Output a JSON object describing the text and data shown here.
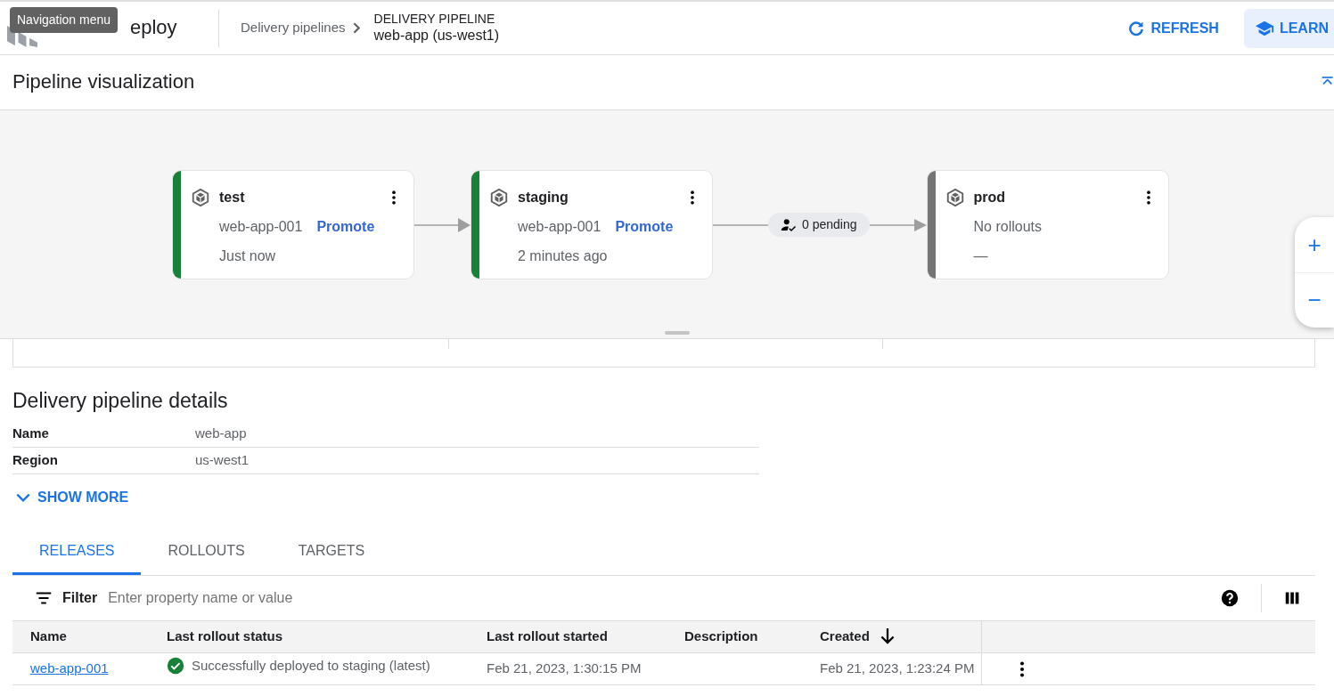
{
  "header": {
    "tooltip": "Navigation menu",
    "product": "eploy",
    "breadcrumb": [
      {
        "label": "Delivery pipelines"
      }
    ],
    "page_kind": "DELIVERY PIPELINE",
    "page_title": "web-app (us-west1)",
    "actions": [
      {
        "label": "REFRESH",
        "kind": "refresh"
      },
      {
        "label": "LEARN",
        "kind": "learn"
      }
    ]
  },
  "pipeline": {
    "title": "Pipeline visualization",
    "targets": [
      {
        "name": "test",
        "release": "web-app-001",
        "action": "Promote",
        "time": "Just now",
        "color": "#188038"
      },
      {
        "name": "staging",
        "release": "web-app-001",
        "action": "Promote",
        "time": "2 minutes ago",
        "color": "#188038"
      },
      {
        "name": "prod",
        "release": "No rollouts",
        "time": "—",
        "color": "#757575",
        "pending": "0 pending"
      }
    ],
    "zoom_controls": [
      "+",
      "−"
    ]
  },
  "details": {
    "title": "Delivery pipeline details",
    "fields": [
      {
        "label": "Name",
        "value": "web-app"
      },
      {
        "label": "Region",
        "value": "us-west1"
      }
    ],
    "show_more": "SHOW MORE"
  },
  "tabs": [
    {
      "label": "RELEASES",
      "selected": true
    },
    {
      "label": "ROLLOUTS",
      "selected": false
    },
    {
      "label": "TARGETS",
      "selected": false
    }
  ],
  "filter": {
    "label": "Filter",
    "placeholder": "Enter property name or value"
  },
  "table": {
    "columns": [
      {
        "label": "Name",
        "sorted": false
      },
      {
        "label": "Last rollout status",
        "sorted": false
      },
      {
        "label": "Last rollout started",
        "sorted": false
      },
      {
        "label": "Description",
        "sorted": false
      },
      {
        "label": "Created",
        "sorted": true
      }
    ],
    "rows": [
      {
        "name": "web-app-001",
        "status": "Successfully deployed to staging (latest)",
        "started": "Feb 21, 2023, 1:30:15 PM",
        "created": "Feb 21, 2023, 1:23:24 PM"
      }
    ]
  }
}
